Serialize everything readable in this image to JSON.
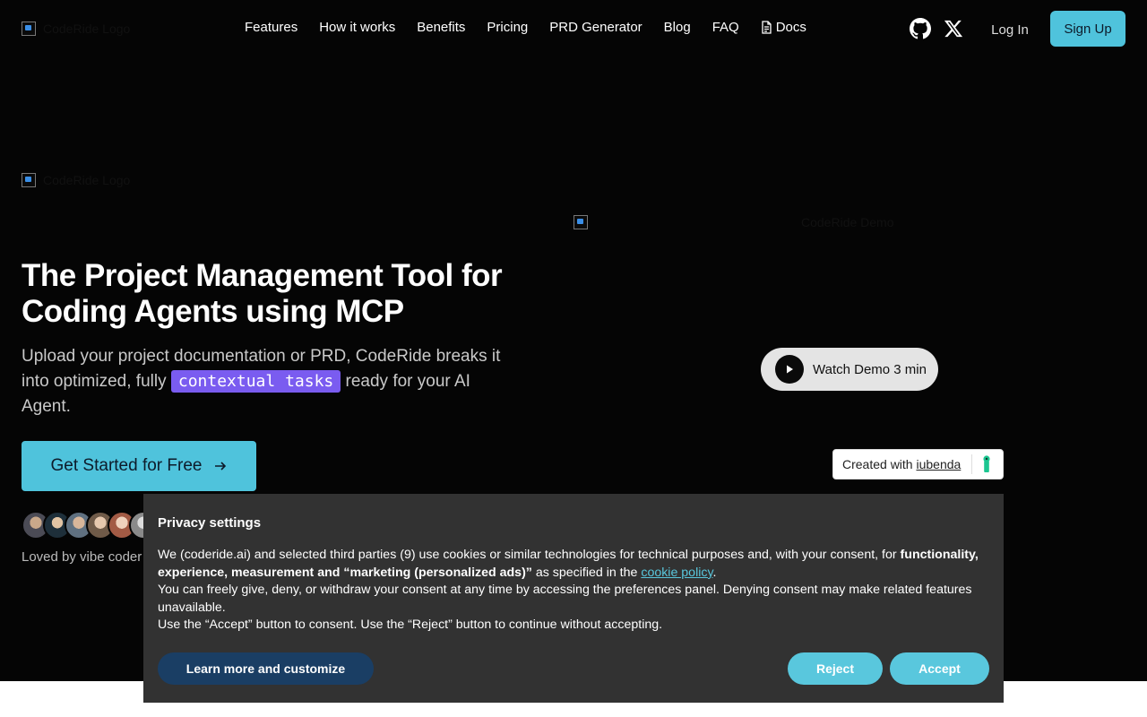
{
  "header": {
    "logo_alt": "CodeRide Logo",
    "nav": [
      {
        "label": "Features"
      },
      {
        "label": "How it works"
      },
      {
        "label": "Benefits"
      },
      {
        "label": "Pricing"
      },
      {
        "label": "PRD Generator"
      },
      {
        "label": "Blog"
      },
      {
        "label": "FAQ"
      },
      {
        "label": "Docs",
        "icon": "document-icon"
      }
    ],
    "login_label": "Log In",
    "signup_label": "Sign Up"
  },
  "hero": {
    "logo_alt": "CodeRide Logo",
    "title": "The Project Management Tool for Coding Agents using MCP",
    "subtitle_before": "Upload your project documentation or PRD, CodeRide breaks it into optimized, fully ",
    "subtitle_highlight": "contextual tasks",
    "subtitle_after": " ready for your AI Agent.",
    "cta_label": "Get Started for Free",
    "loved_text": "Loved by vibe coder",
    "video_alt": "CodeRide Demo",
    "watch_label": "Watch Demo 3 min"
  },
  "badge": {
    "prefix": "Created with ",
    "brand": "iubenda"
  },
  "cookie": {
    "title": "Privacy settings",
    "p1_a": "We (coderide.ai) and selected third parties (9) use cookies or similar technologies for technical purposes and, with your consent, for ",
    "p1_bold": "functionality, experience, measurement and “marketing (personalized ads)”",
    "p1_b": " as specified in the ",
    "p1_link": "cookie policy",
    "p1_c": ".",
    "p2": "You can freely give, deny, or withdraw your consent at any time by accessing the preferences panel. Denying consent may make related features unavailable.",
    "p3": "Use the “Accept” button to consent. Use the “Reject” button to continue without accepting.",
    "learn_label": "Learn more and customize",
    "reject_label": "Reject",
    "accept_label": "Accept"
  },
  "colors": {
    "accent": "#4fc3dc",
    "highlight": "#7a5cf0",
    "banner_bg": "#323232",
    "learn_btn": "#1a3e64"
  }
}
